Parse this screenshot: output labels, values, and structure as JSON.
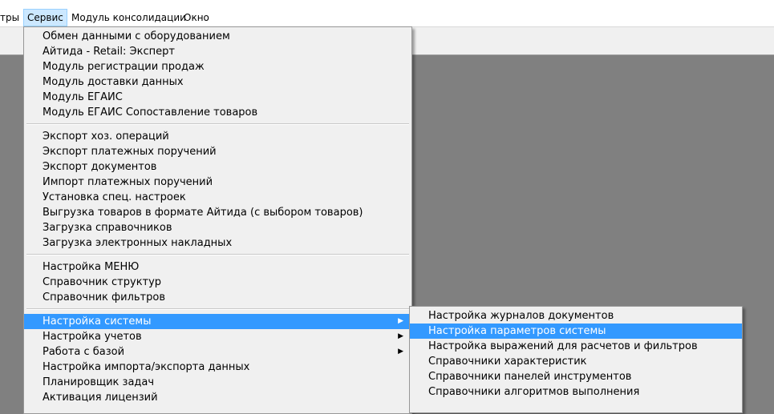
{
  "menubar": {
    "items": [
      "тры",
      "Сервис",
      "Модуль консолидации",
      "Окно"
    ]
  },
  "service_menu": {
    "group1": [
      "Обмен данными с оборудованием",
      "Айтида - Retail: Эксперт",
      "Модуль регистрации продаж",
      "Модуль доставки данных",
      "Модуль ЕГАИС",
      "Модуль ЕГАИС Сопоставление товаров"
    ],
    "group2": [
      "Экспорт хоз. операций",
      "Экспорт платежных поручений",
      "Экспорт документов",
      "Импорт платежных поручений",
      "Установка спец. настроек",
      "Выгрузка товаров в формате Айтида (с выбором товаров)",
      "Загрузка справочников",
      "Загрузка электронных накладных"
    ],
    "group3": [
      "Настройка МЕНЮ",
      "Справочник структур",
      "Справочник фильтров"
    ],
    "group4": [
      "Настройка системы",
      "Настройка учетов",
      "Работа с базой",
      "Настройка импорта/экспорта данных",
      "Планировщик задач",
      "Активация лицензий"
    ],
    "submenu_arrow": "▶"
  },
  "system_settings_submenu": {
    "items": [
      "Настройка журналов документов",
      "Настройка параметров системы",
      "Настройка выражений для расчетов и фильтров",
      "Справочники характеристик",
      "Справочники панелей инструментов",
      "Справочники алгоритмов выполнения"
    ]
  },
  "colors": {
    "highlight": "#3399ff",
    "menubar_active": "#cce8ff",
    "workspace": "#808080"
  }
}
